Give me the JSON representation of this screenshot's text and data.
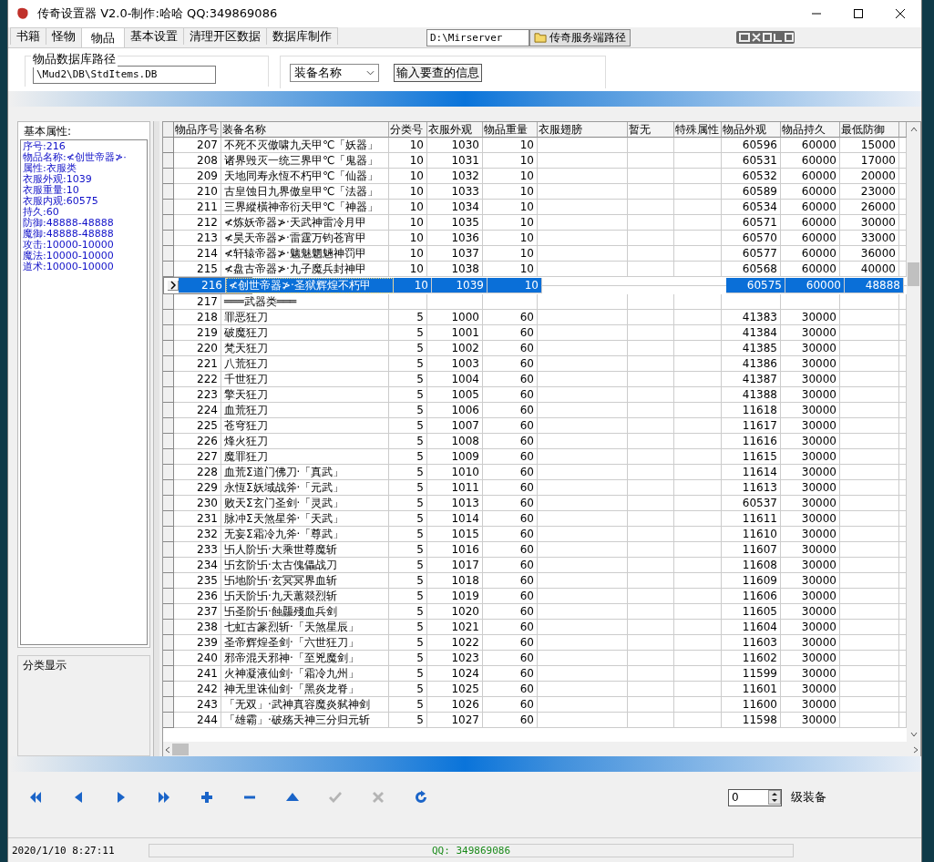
{
  "window": {
    "title": "传奇设置器 V2.0-制作:哈哈 QQ:349869086"
  },
  "tabs": [
    {
      "label": "书籍",
      "selected": false
    },
    {
      "label": "怪物",
      "selected": false
    },
    {
      "label": "物品",
      "selected": true
    },
    {
      "label": "基本设置",
      "selected": false
    },
    {
      "label": "清理开区数据",
      "selected": false
    },
    {
      "label": "数据库制作",
      "selected": false
    }
  ],
  "server_path": {
    "value": "D:\\Mirserver",
    "button": "传奇服务端路径"
  },
  "db_group": {
    "title": "物品数据库路径",
    "value": "\\Mud2\\DB\\StdItems.DB"
  },
  "search": {
    "field": "装备名称",
    "button": "输入要查的信息"
  },
  "properties": {
    "title": "基本属性:",
    "lines": [
      "序号:216",
      "物品名称:≮创世帝器≯·",
      "属性:衣服类",
      "衣服外观:1039",
      "衣服重量:10",
      "衣服内观:60575",
      "持久:60",
      "防御:48888-48888",
      "魔御:48888-48888",
      "攻击:10000-10000",
      "魔法:10000-10000",
      "道术:10000-10000"
    ]
  },
  "category_group": {
    "title": "分类显示"
  },
  "table": {
    "columns": [
      "物品序号",
      "装备名称",
      "分类号",
      "衣服外观",
      "物品重量",
      "衣服翅膀",
      "暂无",
      "特殊属性",
      "物品外观",
      "物品持久",
      "最低防御"
    ],
    "rows": [
      {
        "no": "207",
        "name": "不死不灭傲啸九天甲℃「妖器」",
        "category": "10",
        "look": "1030",
        "weight": "10",
        "item_look": "60596",
        "durability": "60000",
        "min_defense": "15000",
        "selected": false
      },
      {
        "no": "208",
        "name": "诸界毁灭一统三界甲℃「鬼器」",
        "category": "10",
        "look": "1031",
        "weight": "10",
        "item_look": "60531",
        "durability": "60000",
        "min_defense": "17000",
        "selected": false
      },
      {
        "no": "209",
        "name": "天地同寿永恆不朽甲℃「仙器」",
        "category": "10",
        "look": "1032",
        "weight": "10",
        "item_look": "60532",
        "durability": "60000",
        "min_defense": "20000",
        "selected": false
      },
      {
        "no": "210",
        "name": "古皇蚀日九界傲皇甲℃「法器」",
        "category": "10",
        "look": "1033",
        "weight": "10",
        "item_look": "60589",
        "durability": "60000",
        "min_defense": "23000",
        "selected": false
      },
      {
        "no": "211",
        "name": "三界縱橫神帝衍天甲℃「神器」",
        "category": "10",
        "look": "1034",
        "weight": "10",
        "item_look": "60534",
        "durability": "60000",
        "min_defense": "26000",
        "selected": false
      },
      {
        "no": "212",
        "name": "≮炼妖帝器≯·天武神雷冷月甲",
        "category": "10",
        "look": "1035",
        "weight": "10",
        "item_look": "60571",
        "durability": "60000",
        "min_defense": "30000",
        "selected": false
      },
      {
        "no": "213",
        "name": "≮昊天帝器≯·雷霆万钧苍宵甲",
        "category": "10",
        "look": "1036",
        "weight": "10",
        "item_look": "60570",
        "durability": "60000",
        "min_defense": "33000",
        "selected": false
      },
      {
        "no": "214",
        "name": "≮轩辕帝器≯·魑魅魍魎神罚甲",
        "category": "10",
        "look": "1037",
        "weight": "10",
        "item_look": "60577",
        "durability": "60000",
        "min_defense": "36000",
        "selected": false
      },
      {
        "no": "215",
        "name": "≮盘古帝器≯·九子魔兵封神甲",
        "category": "10",
        "look": "1038",
        "weight": "10",
        "item_look": "60568",
        "durability": "60000",
        "min_defense": "40000",
        "selected": false
      },
      {
        "no": "216",
        "name": "≮创世帝器≯·圣狱辉煌不朽甲",
        "category": "10",
        "look": "1039",
        "weight": "10",
        "item_look": "60575",
        "durability": "60000",
        "min_defense": "48888",
        "selected": true
      },
      {
        "no": "217",
        "name": "═══武器类═══",
        "selected": false
      },
      {
        "no": "218",
        "name": "罪恶狂刀",
        "category": "5",
        "look": "1000",
        "weight": "60",
        "item_look": "41383",
        "durability": "30000",
        "selected": false
      },
      {
        "no": "219",
        "name": "破魔狂刀",
        "category": "5",
        "look": "1001",
        "weight": "60",
        "item_look": "41384",
        "durability": "30000",
        "selected": false
      },
      {
        "no": "220",
        "name": "梵天狂刀",
        "category": "5",
        "look": "1002",
        "weight": "60",
        "item_look": "41385",
        "durability": "30000",
        "selected": false
      },
      {
        "no": "221",
        "name": "八荒狂刀",
        "category": "5",
        "look": "1003",
        "weight": "60",
        "item_look": "41386",
        "durability": "30000",
        "selected": false
      },
      {
        "no": "222",
        "name": "千世狂刀",
        "category": "5",
        "look": "1004",
        "weight": "60",
        "item_look": "41387",
        "durability": "30000",
        "selected": false
      },
      {
        "no": "223",
        "name": "擎天狂刀",
        "category": "5",
        "look": "1005",
        "weight": "60",
        "item_look": "41388",
        "durability": "30000",
        "selected": false
      },
      {
        "no": "224",
        "name": "血荒狂刀",
        "category": "5",
        "look": "1006",
        "weight": "60",
        "item_look": "11618",
        "durability": "30000",
        "selected": false
      },
      {
        "no": "225",
        "name": "苍穹狂刀",
        "category": "5",
        "look": "1007",
        "weight": "60",
        "item_look": "11617",
        "durability": "30000",
        "selected": false
      },
      {
        "no": "226",
        "name": "烽火狂刀",
        "category": "5",
        "look": "1008",
        "weight": "60",
        "item_look": "11616",
        "durability": "30000",
        "selected": false
      },
      {
        "no": "227",
        "name": "魔罪狂刀",
        "category": "5",
        "look": "1009",
        "weight": "60",
        "item_look": "11615",
        "durability": "30000",
        "selected": false
      },
      {
        "no": "228",
        "name": "血荒Σ道门佛刀·「真武」",
        "category": "5",
        "look": "1010",
        "weight": "60",
        "item_look": "11614",
        "durability": "30000",
        "selected": false
      },
      {
        "no": "229",
        "name": "永恆Σ妖域战斧·「元武」",
        "category": "5",
        "look": "1011",
        "weight": "60",
        "item_look": "11613",
        "durability": "30000",
        "selected": false
      },
      {
        "no": "230",
        "name": "败天Σ玄门圣剑·「灵武」",
        "category": "5",
        "look": "1013",
        "weight": "60",
        "item_look": "60537",
        "durability": "30000",
        "selected": false
      },
      {
        "no": "231",
        "name": "脉冲Σ天煞星斧·「天武」",
        "category": "5",
        "look": "1014",
        "weight": "60",
        "item_look": "11611",
        "durability": "30000",
        "selected": false
      },
      {
        "no": "232",
        "name": "无妄Σ霜冷九斧·「尊武」",
        "category": "5",
        "look": "1015",
        "weight": "60",
        "item_look": "11610",
        "durability": "30000",
        "selected": false
      },
      {
        "no": "233",
        "name": "卐人阶卐·大乘世尊魔斩",
        "category": "5",
        "look": "1016",
        "weight": "60",
        "item_look": "11607",
        "durability": "30000",
        "selected": false
      },
      {
        "no": "234",
        "name": "卐玄阶卐·太古傀儡战刀",
        "category": "5",
        "look": "1017",
        "weight": "60",
        "item_look": "11608",
        "durability": "30000",
        "selected": false
      },
      {
        "no": "235",
        "name": "卐地阶卐·玄冥冥界血斩",
        "category": "5",
        "look": "1018",
        "weight": "60",
        "item_look": "11609",
        "durability": "30000",
        "selected": false
      },
      {
        "no": "236",
        "name": "卐天阶卐·九天蕙燚烈斩",
        "category": "5",
        "look": "1019",
        "weight": "60",
        "item_look": "11606",
        "durability": "30000",
        "selected": false
      },
      {
        "no": "237",
        "name": "卐圣阶卐·蝕龘殘血兵剑",
        "category": "5",
        "look": "1020",
        "weight": "60",
        "item_look": "11605",
        "durability": "30000",
        "selected": false
      },
      {
        "no": "238",
        "name": "七虹古篆烈斩·「天煞星辰」",
        "category": "5",
        "look": "1021",
        "weight": "60",
        "item_look": "11604",
        "durability": "30000",
        "selected": false
      },
      {
        "no": "239",
        "name": "圣帝辉煌圣剑·「六世狂刀」",
        "category": "5",
        "look": "1022",
        "weight": "60",
        "item_look": "11603",
        "durability": "30000",
        "selected": false
      },
      {
        "no": "240",
        "name": "邪帝混天邪神·「至兇魔剑」",
        "category": "5",
        "look": "1023",
        "weight": "60",
        "item_look": "11602",
        "durability": "30000",
        "selected": false
      },
      {
        "no": "241",
        "name": "火神凝液仙剑·「霜冷九州」",
        "category": "5",
        "look": "1024",
        "weight": "60",
        "item_look": "11599",
        "durability": "30000",
        "selected": false
      },
      {
        "no": "242",
        "name": "神无里诛仙剑·「黑炎龙脊」",
        "category": "5",
        "look": "1025",
        "weight": "60",
        "item_look": "11601",
        "durability": "30000",
        "selected": false
      },
      {
        "no": "243",
        "name": "「无双」·武神真容魔炎弑神剑",
        "category": "5",
        "look": "1026",
        "weight": "60",
        "item_look": "11600",
        "durability": "30000",
        "selected": false
      },
      {
        "no": "244",
        "name": "「雄霸」·破殇天神三分归元斩",
        "category": "5",
        "look": "1027",
        "weight": "60",
        "item_look": "11598",
        "durability": "30000",
        "selected": false
      }
    ]
  },
  "toolbar": [
    {
      "kind": "first",
      "disabled": false
    },
    {
      "kind": "prior",
      "disabled": false
    },
    {
      "kind": "next",
      "disabled": false
    },
    {
      "kind": "last",
      "disabled": false
    },
    {
      "kind": "insert",
      "disabled": false
    },
    {
      "kind": "delete",
      "disabled": false
    },
    {
      "kind": "edit",
      "disabled": false
    },
    {
      "kind": "post",
      "disabled": true
    },
    {
      "kind": "cancel",
      "disabled": true
    },
    {
      "kind": "refresh",
      "disabled": false
    }
  ],
  "level": {
    "value": "0",
    "label": "级装备"
  },
  "status_bar": {
    "time": "2020/1/10 8:27:11",
    "qq": "QQ: 349869086"
  }
}
